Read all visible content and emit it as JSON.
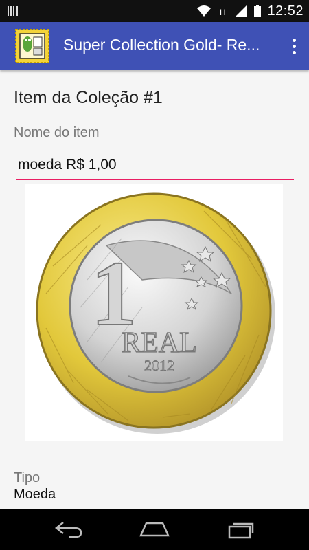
{
  "status": {
    "time": "12:52"
  },
  "app": {
    "title": "Super Collection Gold- Re..."
  },
  "page": {
    "heading": "Item da Coleção #1",
    "name_label": "Nome do item",
    "name_value": "moeda R$ 1,00",
    "tipo_label": "Tipo",
    "tipo_value": "Moeda"
  },
  "coin": {
    "denomination": "1",
    "text": "REAL",
    "year": "2012"
  },
  "colors": {
    "appbar": "#3f51b5",
    "accent": "#e91e63",
    "status": "#111111"
  }
}
